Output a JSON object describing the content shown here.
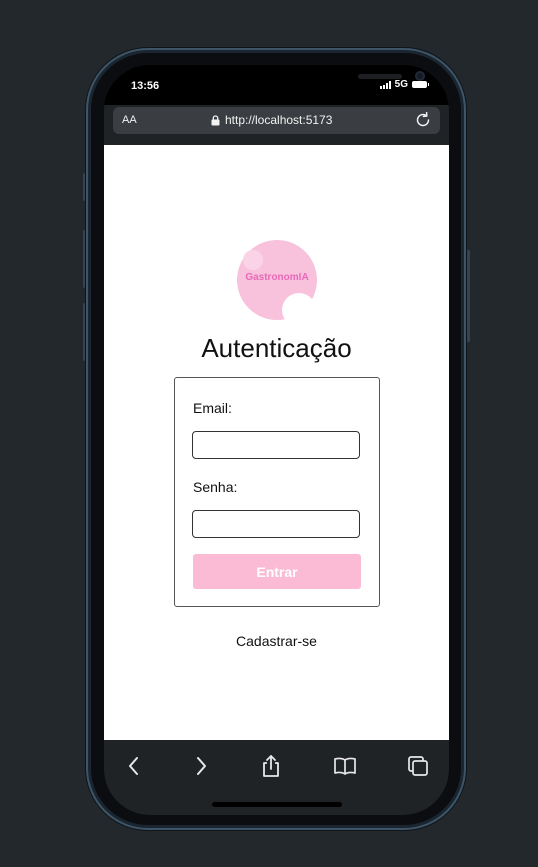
{
  "status_bar": {
    "time": "13:56",
    "network": "5G"
  },
  "browser": {
    "aa_label": "AA",
    "url": "http://localhost:5173"
  },
  "logo": {
    "text": "GastronomIA",
    "color": "#f8c1dc"
  },
  "page": {
    "title": "Autenticação"
  },
  "form": {
    "email_label": "Email:",
    "email_value": "",
    "password_label": "Senha:",
    "password_value": "",
    "submit_label": "Entrar"
  },
  "links": {
    "register": "Cadastrar-se"
  },
  "toolbar": {
    "icons": [
      "back-icon",
      "forward-icon",
      "share-icon",
      "bookmarks-icon",
      "tabs-icon"
    ]
  },
  "colors": {
    "accent": "#fbbbd4",
    "logo_text": "#e969b9",
    "frame": "#23282d"
  }
}
